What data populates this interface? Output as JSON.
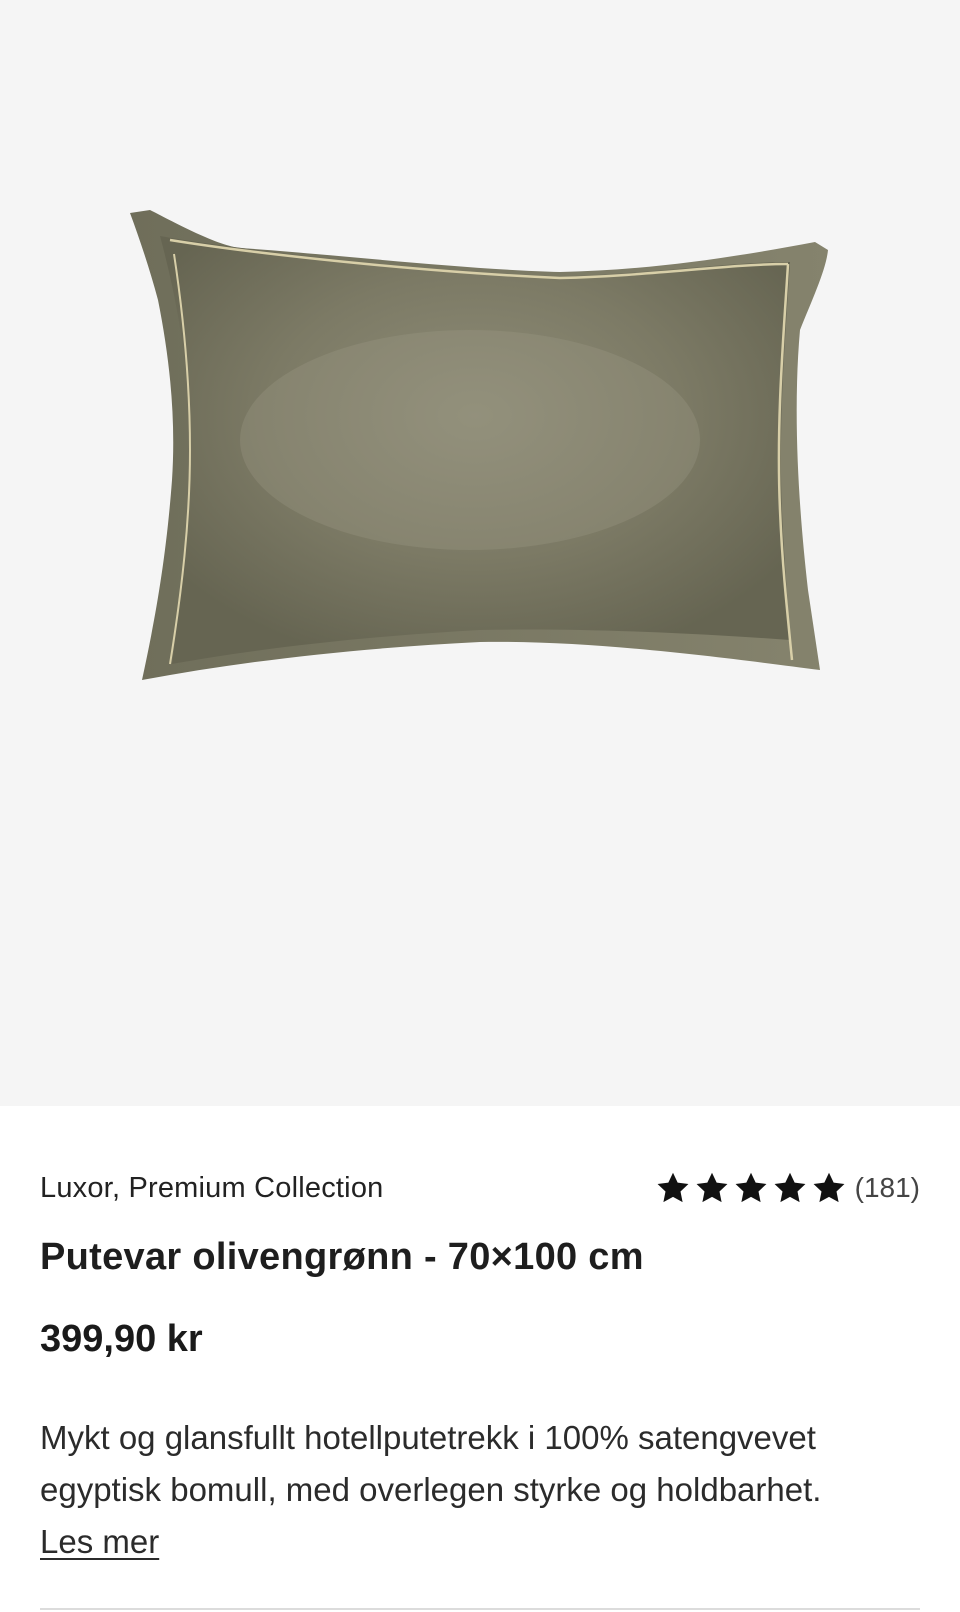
{
  "product": {
    "image_alt": "Putevar olivengrønn",
    "brand": "Luxor, Premium Collection",
    "rating": {
      "stars": 5,
      "max": 5,
      "count_label": "(181)"
    },
    "title": "Putevar olivengrønn - 70×100 cm",
    "price": "399,90 kr",
    "description": "Mykt og glansfullt hotellputetrekk i 100% satengvevet egyptisk bomull, med overlegen styrke og holdbarhet.",
    "read_more": "Les mer"
  },
  "colors": {
    "pillow": "#7f7d68",
    "piping": "#d8cfa8",
    "hero_bg": "#f5f5f5",
    "star": "#111111"
  }
}
